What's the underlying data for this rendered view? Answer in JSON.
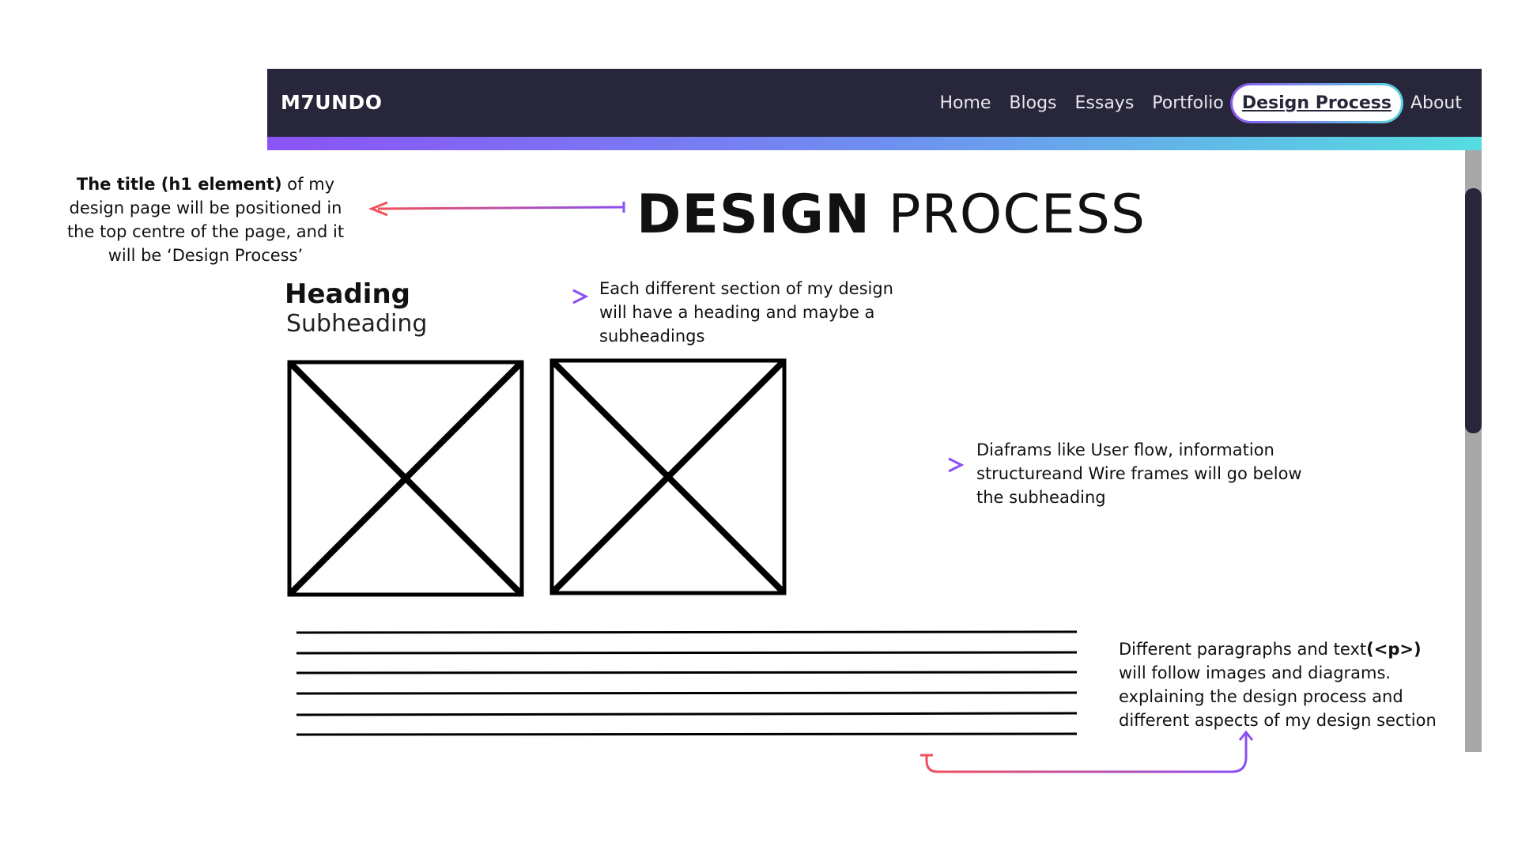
{
  "navbar": {
    "brand": "M7UNDO",
    "links": [
      "Home",
      "Blogs",
      "Essays",
      "Portfolio",
      "Design Process",
      "About"
    ],
    "active_index": 4,
    "colors": {
      "background": "#27263a",
      "gradient_start": "#8b53f7",
      "gradient_end": "#55dde0"
    }
  },
  "wireframe": {
    "title_bold": "DESIGN",
    "title_light": "PROCESS",
    "heading": "Heading",
    "subheading": "Subheading",
    "image_placeholder_count": 2,
    "paragraph_line_count": 6
  },
  "annotations": {
    "title_note": {
      "bold": "The title (h1 element)",
      "text": " of my design page will be positioned in the top centre of the page, and it will be ‘Design Process’"
    },
    "heading_note": "Each different section of my design will have a heading and maybe a subheadings",
    "diagram_note": "Diaframs like User flow, information structureand Wire frames will go below the subheading",
    "paragraph_note": {
      "before": "Different paragraphs and text",
      "bold": "(<p>)",
      "after": " will follow images and diagrams. explaining the design process and different aspects of my design section"
    },
    "arrow_colors": {
      "start": "#f0505a",
      "end": "#8a4ff0"
    }
  },
  "scrollbar": {
    "track_color": "#a8a8a8",
    "thumb_color": "#27263a"
  }
}
